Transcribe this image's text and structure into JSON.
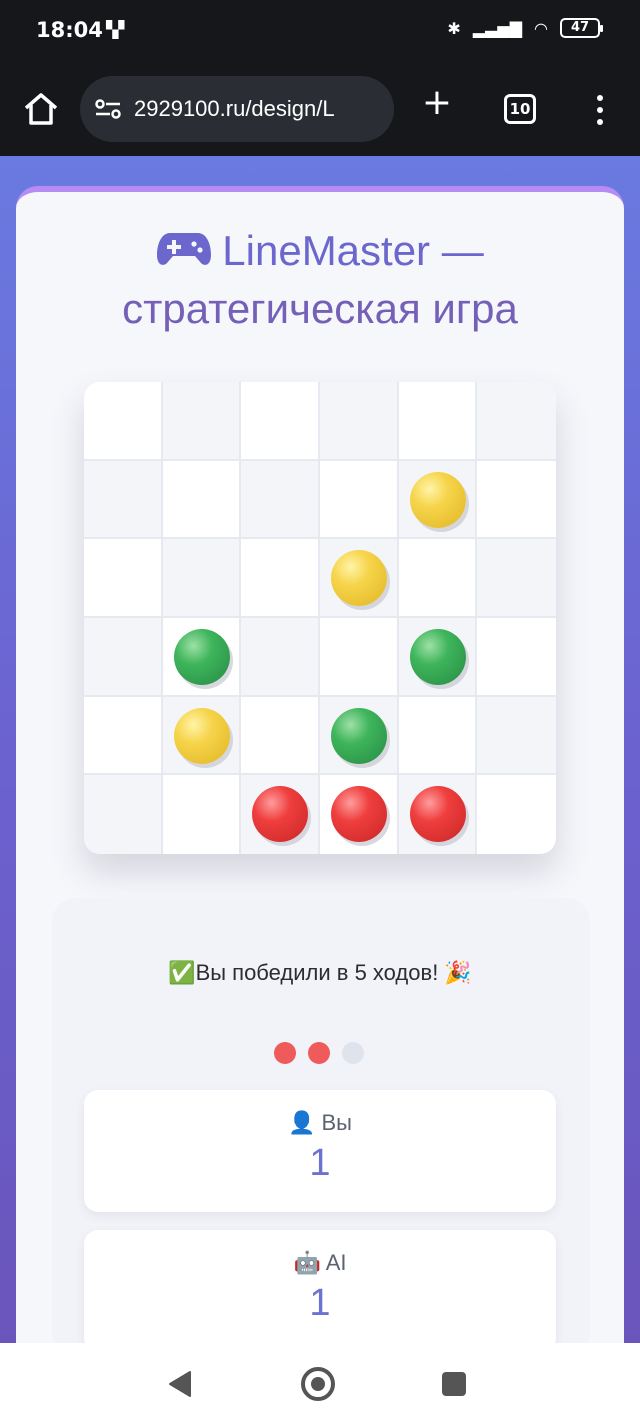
{
  "status_bar": {
    "time": "18:04",
    "battery": "47"
  },
  "browser": {
    "url": "2929100.ru/design/L",
    "tab_count": "10",
    "new_tab_label": "+"
  },
  "game": {
    "title_line1": "LineMaster —",
    "title_line2": "стратегическая игра",
    "board": [
      [
        "",
        "",
        "",
        "",
        "",
        ""
      ],
      [
        "",
        "",
        "",
        "",
        "yellow",
        ""
      ],
      [
        "",
        "",
        "",
        "yellow",
        "",
        ""
      ],
      [
        "",
        "green",
        "",
        "",
        "green",
        ""
      ],
      [
        "",
        "yellow",
        "",
        "green",
        "",
        ""
      ],
      [
        "",
        "",
        "red",
        "red",
        "red",
        ""
      ]
    ],
    "ball_colors": {
      "yellow": "#f6d44a",
      "green": "#3fb55c",
      "red": "#ef3e3e"
    },
    "result_message": "✅Вы победили в 5 ходов! 🎉",
    "move_dots": [
      "red",
      "red",
      "grey"
    ],
    "scores": [
      {
        "label": "👤 Вы",
        "value": "1"
      },
      {
        "label": "🤖 AI",
        "value": "1"
      }
    ]
  }
}
